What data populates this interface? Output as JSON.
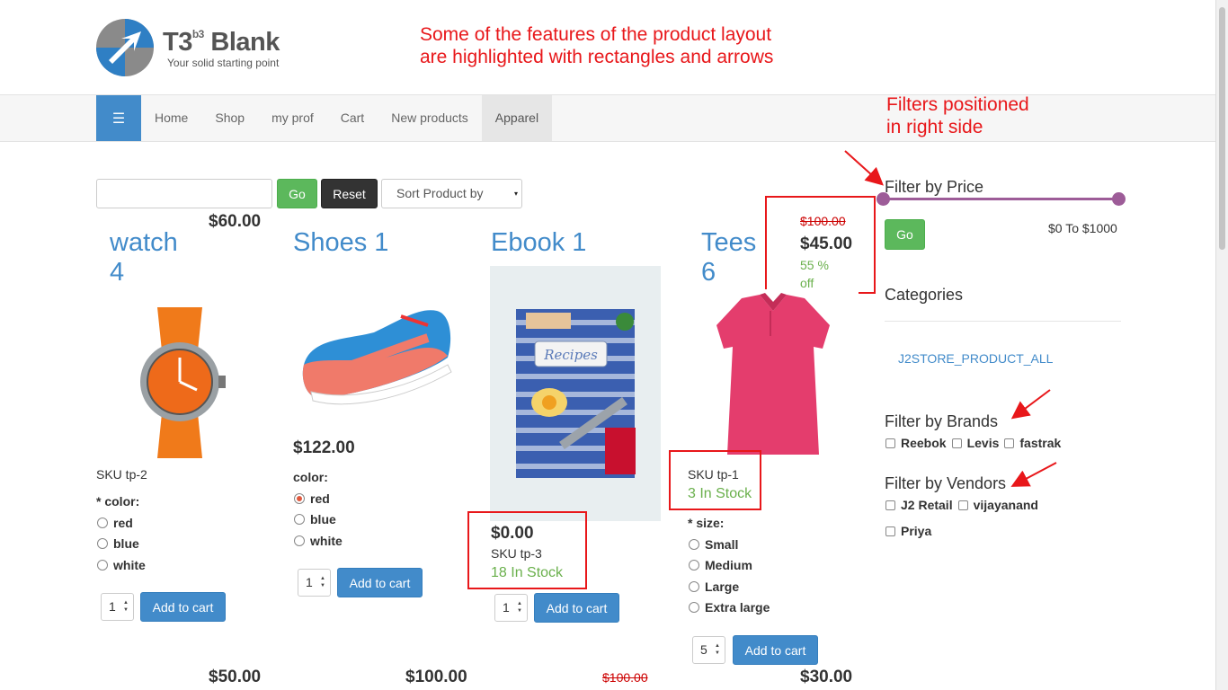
{
  "header": {
    "logo_title": "T3",
    "logo_sup": "b3",
    "logo_title2": " Blank",
    "logo_tagline": "Your solid starting point",
    "annotation_top": "Some of the features of the product layout\nare highlighted with rectangles and arrows",
    "annotation_filters": "Filters positioned\nin right side"
  },
  "nav": {
    "menu_icon": "☰",
    "items": [
      "Home",
      "Shop",
      "my prof",
      "Cart",
      "New products",
      "Apparel"
    ],
    "active": "Apparel"
  },
  "toolbar": {
    "search_value": "",
    "go_label": "Go",
    "reset_label": "Reset",
    "sort_label": "Sort Product by"
  },
  "products": [
    {
      "title_line1": "watch",
      "title_line2": "4",
      "price": "$60.00",
      "sku": "SKU tp-2",
      "option_label": "* color:",
      "options": [
        "red",
        "blue",
        "white"
      ],
      "qty": "1",
      "add_label": "Add to cart"
    },
    {
      "title_line1": "Shoes 1",
      "price": "$122.00",
      "option_label": "color:",
      "options": [
        "red",
        "blue",
        "white"
      ],
      "selected": "red",
      "qty": "1",
      "add_label": "Add to cart"
    },
    {
      "title_line1": "Ebook 1",
      "price": "$0.00",
      "sku": "SKU tp-3",
      "stock": "18 In Stock",
      "qty": "1",
      "add_label": "Add to cart",
      "book_label": "Recipes"
    },
    {
      "title_line1": "Tees",
      "title_line2": "6",
      "old_price": "$100.00",
      "price": "$45.00",
      "discount_line1": "55 %",
      "discount_line2": "off",
      "sku": "SKU tp-1",
      "stock": "3 In Stock",
      "option_label": "* size:",
      "options": [
        "Small",
        "Medium",
        "Large",
        "Extra large"
      ],
      "qty": "5",
      "add_label": "Add to cart"
    }
  ],
  "next_row_prices": [
    "$50.00",
    "$100.00",
    "$100.00",
    "$30.00"
  ],
  "sidebar": {
    "price_title": "Filter by Price",
    "price_go": "Go",
    "price_range": "$0 To $1000",
    "categories_title": "Categories",
    "category_link": "J2STORE_PRODUCT_ALL",
    "brands_title": "Filter by Brands",
    "brands": [
      "Reebok",
      "Levis",
      "fastrak"
    ],
    "vendors_title": "Filter by Vendors",
    "vendors": [
      "J2 Retail",
      "vijayanand",
      "Priya"
    ]
  },
  "colors": {
    "accent": "#428bca",
    "annotation": "#e8171a",
    "go_green": "#5cb85c",
    "slider": "#9d5c98",
    "stock_green": "#6ab04c"
  }
}
